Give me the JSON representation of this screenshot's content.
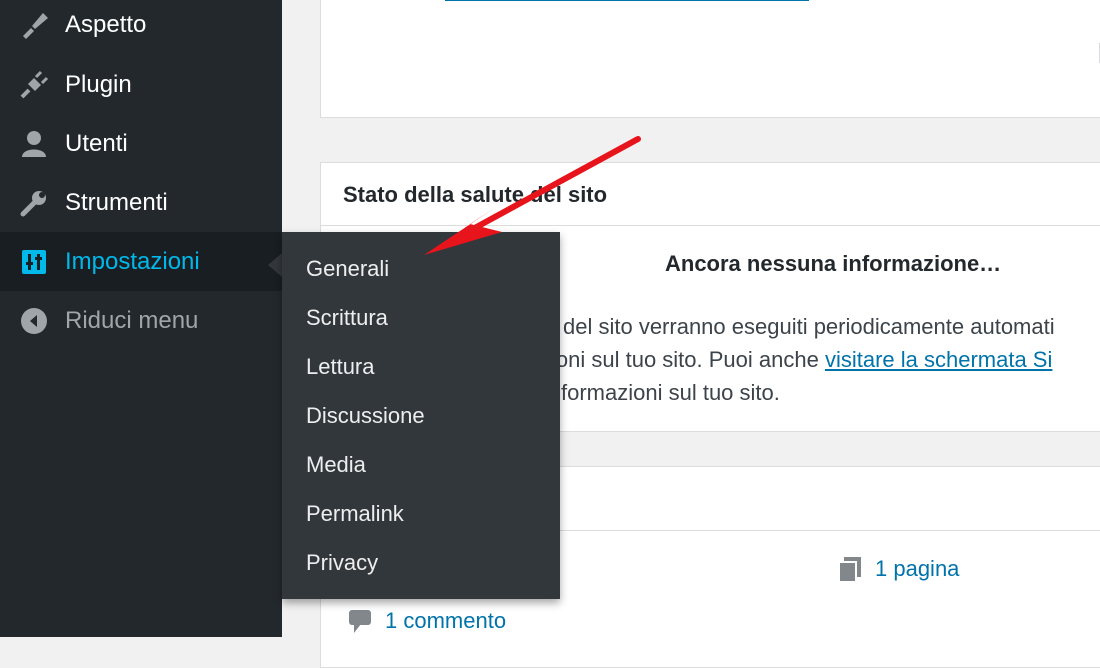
{
  "sidebar": {
    "items": [
      {
        "label": "Aspetto",
        "icon": "paint-brush-icon"
      },
      {
        "label": "Plugin",
        "icon": "plugin-icon"
      },
      {
        "label": "Utenti",
        "icon": "user-icon"
      },
      {
        "label": "Strumenti",
        "icon": "wrench-icon"
      },
      {
        "label": "Impostazioni",
        "icon": "settings-sliders-icon",
        "active": true
      },
      {
        "label": "Riduci menu",
        "icon": "collapse-icon"
      }
    ]
  },
  "submenu": {
    "items": [
      "Generali",
      "Scrittura",
      "Lettura",
      "Discussione",
      "Media",
      "Permalink",
      "Privacy"
    ]
  },
  "health_panel": {
    "title": "Stato della salute del sito",
    "heading": "Ancora nessuna informazione…",
    "line1": "del sito verranno eseguiti periodicamente automati",
    "line2_text": "ioni sul tuo sito. Puoi anche ",
    "line2_link": "visitare la schermata Si",
    "line3": "formazioni sul tuo sito."
  },
  "glance_panel": {
    "pages": "1 pagina",
    "comments": "1 commento"
  },
  "colors": {
    "sidebar_bg": "#23282d",
    "flyout_bg": "#32373c",
    "accent": "#00b9eb",
    "link": "#0073aa",
    "annotation_arrow": "#e8141b"
  }
}
